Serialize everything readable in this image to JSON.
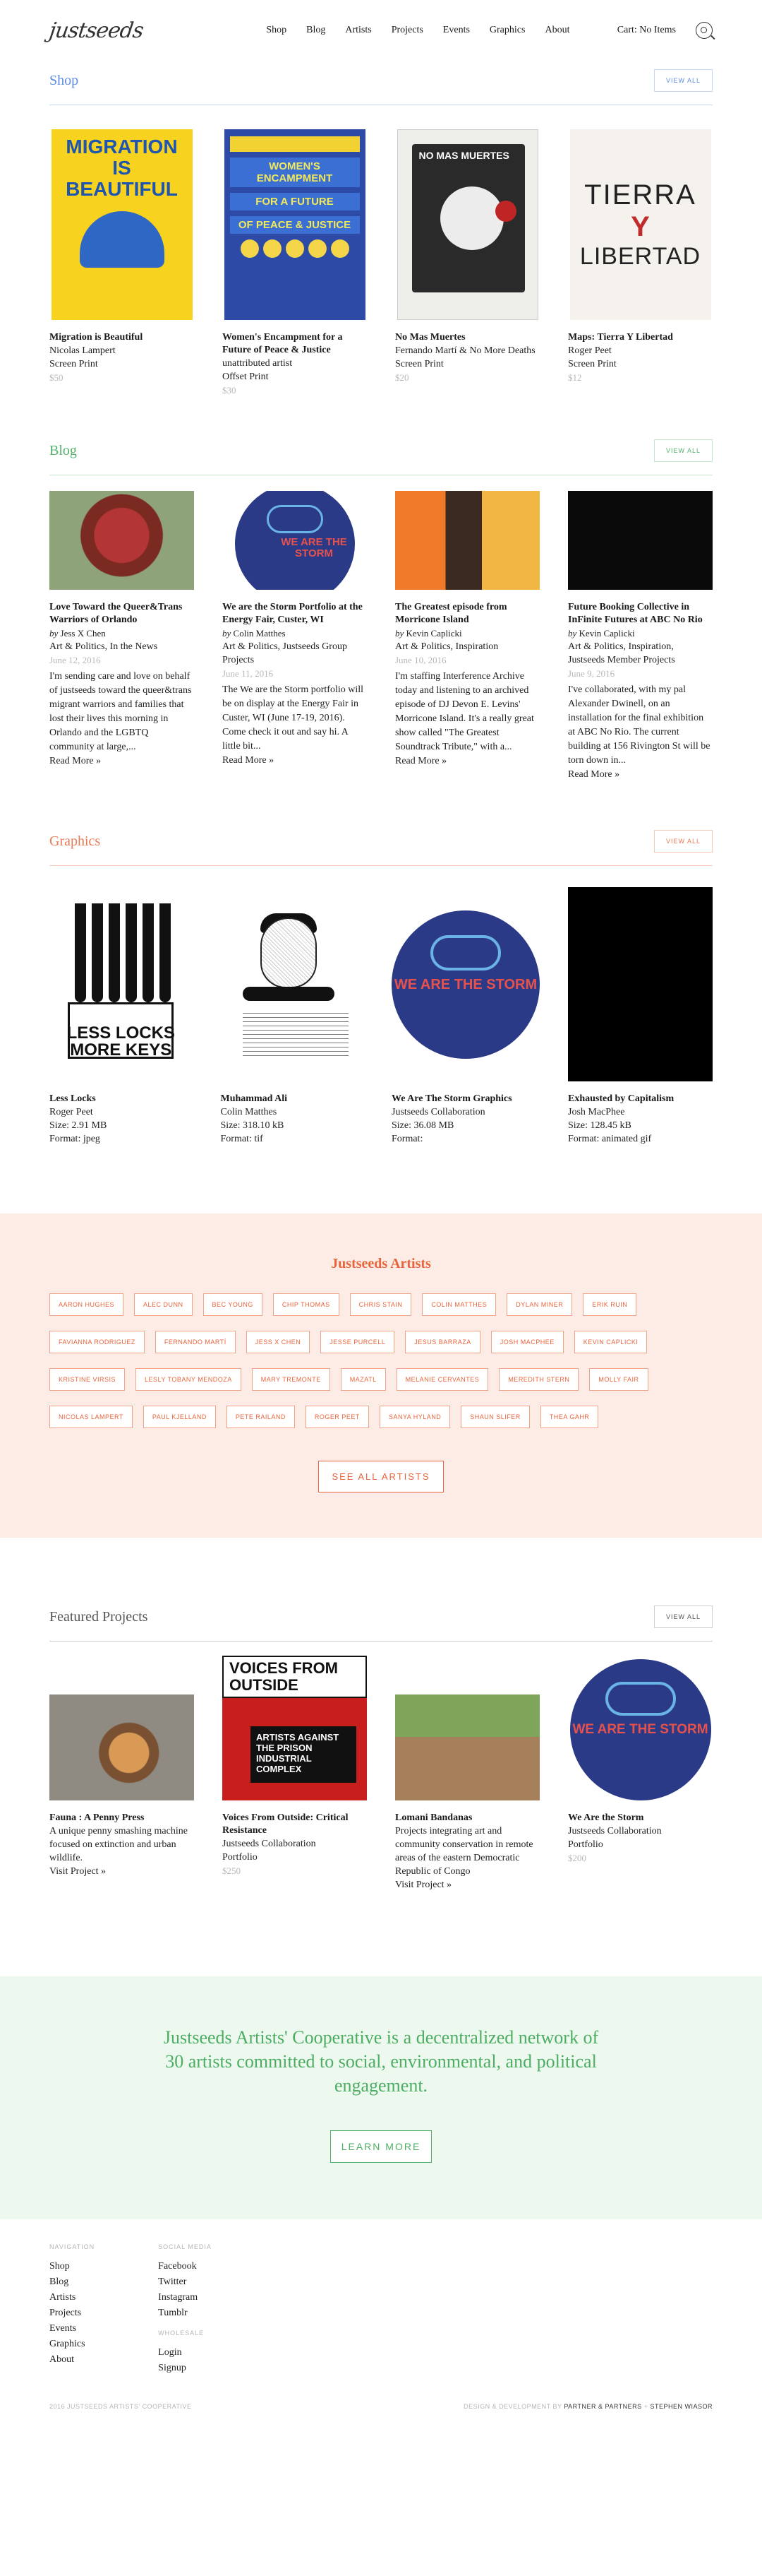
{
  "header": {
    "logo": "justseeds",
    "nav": [
      "Shop",
      "Blog",
      "Artists",
      "Projects",
      "Events",
      "Graphics",
      "About"
    ],
    "cart": "Cart: No Items",
    "search_icon": "search-icon"
  },
  "shop": {
    "title": "Shop",
    "view_all": "VIEW ALL",
    "items": [
      {
        "title": "Migration is Beautiful",
        "artist": "Nicolas Lampert",
        "format": "Screen Print",
        "price": "$50",
        "poster": {
          "l1": "MIGRATION",
          "l2": "IS",
          "l3": "BEAUTIFUL"
        }
      },
      {
        "title": "Women's Encampment for a Future of Peace & Justice",
        "artist": "unattributed artist",
        "format": "Offset Print",
        "price": "$30",
        "poster": {
          "l1": "WOMEN'S ENCAMPMENT",
          "l2": "FOR A FUTURE",
          "l3": "OF PEACE & JUSTICE"
        }
      },
      {
        "title": "No Mas Muertes",
        "artist": "Fernando Martí & No More Deaths",
        "format": "Screen Print",
        "price": "$20",
        "poster": {
          "l1": "NO MAS MUERTES"
        }
      },
      {
        "title": "Maps: Tierra Y Libertad",
        "artist": "Roger Peet",
        "format": "Screen Print",
        "price": "$12",
        "poster": {
          "l1": "TIERRA",
          "l2": "Y",
          "l3": "LIBERTAD"
        }
      }
    ]
  },
  "blog": {
    "title": "Blog",
    "view_all": "VIEW ALL",
    "by": "by",
    "read_more": "Read More »",
    "posts": [
      {
        "title": "Love Toward the Queer&Trans Warriors of Orlando",
        "author": "Jess X Chen",
        "tags": "Art & Politics, In the News",
        "date": "June 12, 2016",
        "excerpt": "I'm sending care and love on behalf of justseeds toward the queer&trans migrant warriors and families that lost their lives this morning in Orlando and the LGBTQ community at large,..."
      },
      {
        "title": "We are the Storm Portfolio at the Energy Fair, Custer, WI",
        "author": "Colin Matthes",
        "tags": "Art & Politics, Justseeds Group Projects",
        "date": "June 11, 2016",
        "excerpt": "The We are the Storm portfolio will be on display at the Energy Fair in Custer, WI (June 17-19, 2016). Come check it out and say hi. A little bit..."
      },
      {
        "title": "The Greatest episode from Morricone Island",
        "author": "Kevin Caplicki",
        "tags": "Art & Politics, Inspiration",
        "date": "June 10, 2016",
        "excerpt": "I'm staffing Interference Archive today and listening to an archived episode of DJ Devon E. Levins' Morricone Island. It's a really great show called \"The Greatest Soundtrack Tribute,\" with a..."
      },
      {
        "title": "Future Booking Collective in InFinite Futures at ABC No Rio",
        "author": "Kevin Caplicki",
        "tags": "Art & Politics, Inspiration, Justseeds Member Projects",
        "date": "June 9, 2016",
        "excerpt": "I've collaborated, with my pal Alexander Dwinell, on an installation for the final exhibition at ABC No Rio. The current building at 156 Rivington St will be torn down in..."
      }
    ],
    "storm_text": "WE ARE THE STORM"
  },
  "graphics": {
    "title": "Graphics",
    "view_all": "VIEW ALL",
    "items": [
      {
        "title": "Less Locks",
        "artist": "Roger Peet",
        "size": "Size: 2.91 MB",
        "format": "Format: jpeg",
        "art_text": "LESS LOCKS MORE KEYS"
      },
      {
        "title": "Muhammad Ali",
        "artist": "Colin Matthes",
        "size": "Size: 318.10 kB",
        "format": "Format: tif"
      },
      {
        "title": "We Are The Storm Graphics",
        "artist": "Justseeds Collaboration",
        "size": "Size: 36.08 MB",
        "format": "Format:",
        "art_text": "WE ARE THE STORM"
      },
      {
        "title": "Exhausted by Capitalism",
        "artist": "Josh MacPhee",
        "size": "Size: 128.45 kB",
        "format": "Format: animated gif"
      }
    ]
  },
  "artists": {
    "title": "Justseeds Artists",
    "list": [
      "AARON HUGHES",
      "ALEC DUNN",
      "BEC YOUNG",
      "CHIP THOMAS",
      "CHRIS STAIN",
      "COLIN MATTHES",
      "DYLAN MINER",
      "ERIK RUIN",
      "FAVIANNA RODRIGUEZ",
      "FERNANDO MARTÍ",
      "JESS X CHEN",
      "JESSE PURCELL",
      "JESUS BARRAZA",
      "JOSH MACPHEE",
      "KEVIN CAPLICKI",
      "KRISTINE VIRSIS",
      "LESLY TOBANY MENDOZA",
      "MARY TREMONTE",
      "MAZATL",
      "MELANIE CERVANTES",
      "MEREDITH STERN",
      "MOLLY FAIR",
      "NICOLAS LAMPERT",
      "PAUL KJELLAND",
      "PETE RAILAND",
      "ROGER PEET",
      "SANYA HYLAND",
      "SHAUN SLIFER",
      "THEA GAHR"
    ],
    "see_all": "SEE ALL ARTISTS"
  },
  "featured": {
    "title": "Featured Projects",
    "view_all": "VIEW ALL",
    "visit": "Visit Project »",
    "items": [
      {
        "title": "Fauna : A Penny Press",
        "desc": "A unique penny smashing machine focused on extinction and urban wildlife.",
        "kind": "",
        "price": ""
      },
      {
        "title": "Voices From Outside: Critical Resistance",
        "desc": "Justseeds Collaboration",
        "kind": "Portfolio",
        "price": "$250",
        "art_top": "VOICES FROM OUTSIDE",
        "art_box": "ARTISTS AGAINST THE PRISON INDUSTRIAL COMPLEX"
      },
      {
        "title": "Lomani Bandanas",
        "desc": "Projects integrating art and community conservation in remote areas of the eastern Democratic Republic of Congo",
        "kind": "",
        "price": ""
      },
      {
        "title": "We Are the Storm",
        "desc": "Justseeds Collaboration",
        "kind": "Portfolio",
        "price": "$200",
        "art_text": "WE ARE THE STORM"
      }
    ]
  },
  "mission": {
    "text": "Justseeds Artists' Cooperative is a decentralized network of 30 artists committed to social, environmental, and political engagement.",
    "button": "LEARN MORE"
  },
  "footer": {
    "nav_heading": "NAVIGATION",
    "nav": [
      "Shop",
      "Blog",
      "Artists",
      "Projects",
      "Events",
      "Graphics",
      "About"
    ],
    "social_heading": "SOCIAL MEDIA",
    "social": [
      "Facebook",
      "Twitter",
      "Instagram",
      "Tumblr"
    ],
    "wholesale_heading": "WHOLESALE",
    "wholesale": [
      "Login",
      "Signup"
    ],
    "copyright": "2016 JUSTSEEDS ARTISTS' COOPERATIVE",
    "credit_prefix": "DESIGN & DEVELOPMENT BY",
    "credit_1": "PARTNER & PARTNERS",
    "credit_sep": "+",
    "credit_2": "STEPHEN WIASOR"
  }
}
